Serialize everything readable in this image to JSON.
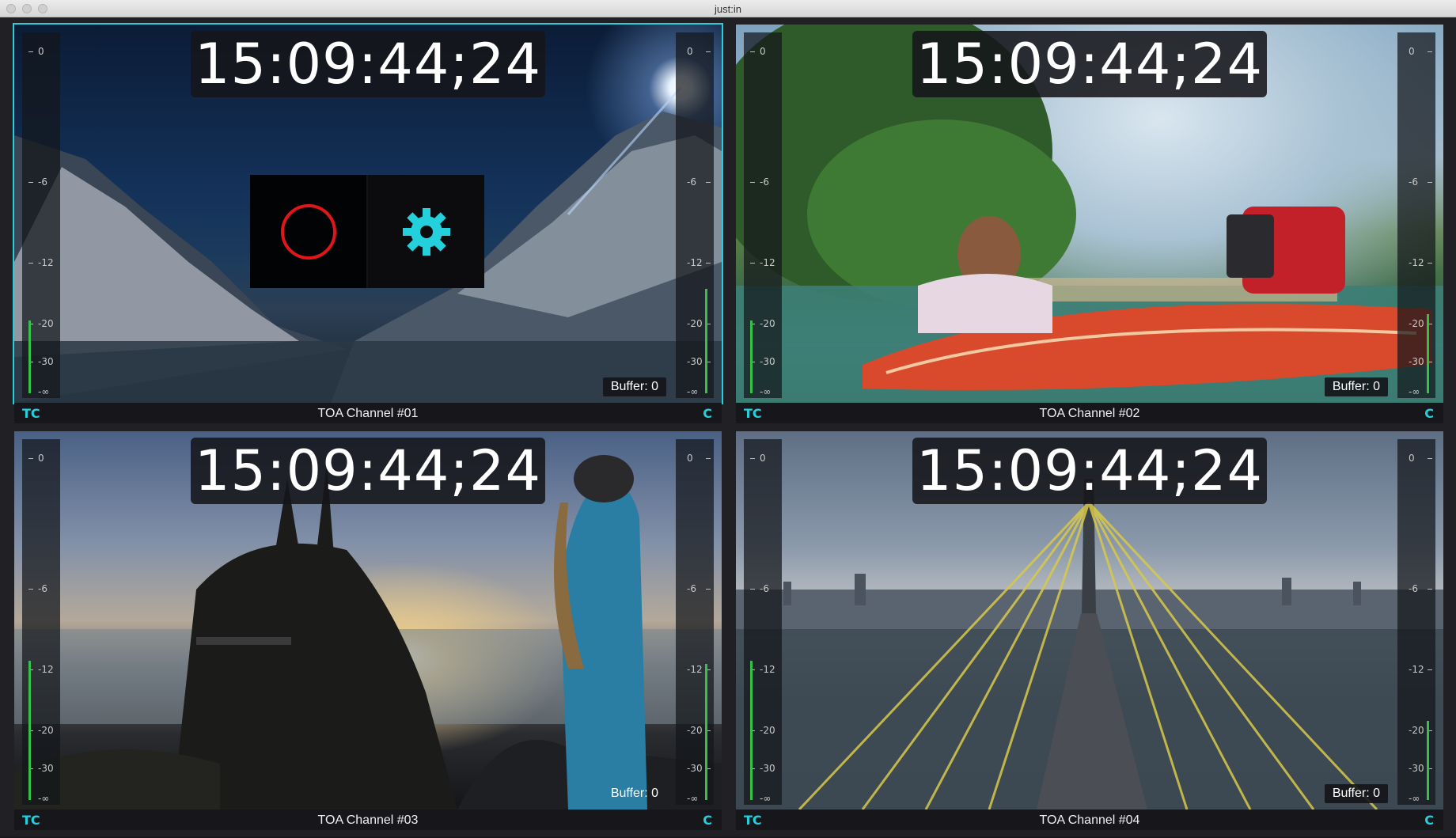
{
  "window": {
    "title": "just:in"
  },
  "meter_marks": [
    "0",
    "-6",
    "-12",
    "-20",
    "-30",
    "-∞"
  ],
  "channels": [
    {
      "name": "TOA Channel #01",
      "timecode": "15:09:44;24",
      "buffer": "Buffer: 0",
      "tc_label": "TC",
      "c_label": "C",
      "selected": true
    },
    {
      "name": "TOA Channel #02",
      "timecode": "15:09:44;24",
      "buffer": "Buffer: 0",
      "tc_label": "TC",
      "c_label": "C",
      "selected": false
    },
    {
      "name": "TOA Channel #03",
      "timecode": "15:09:44;24",
      "buffer": "Buffer: 0",
      "tc_label": "TC",
      "c_label": "C",
      "selected": false
    },
    {
      "name": "TOA Channel #04",
      "timecode": "15:09:44;24",
      "buffer": "Buffer: 0",
      "tc_label": "TC",
      "c_label": "C",
      "selected": false
    }
  ],
  "controls": {
    "record_icon": "record-circle-icon",
    "settings_icon": "gear-icon",
    "accent_color": "#23d0dc",
    "record_color": "#e0161b"
  },
  "colors": {
    "meter_level": "#36c24a",
    "accent": "#23d0dc"
  }
}
